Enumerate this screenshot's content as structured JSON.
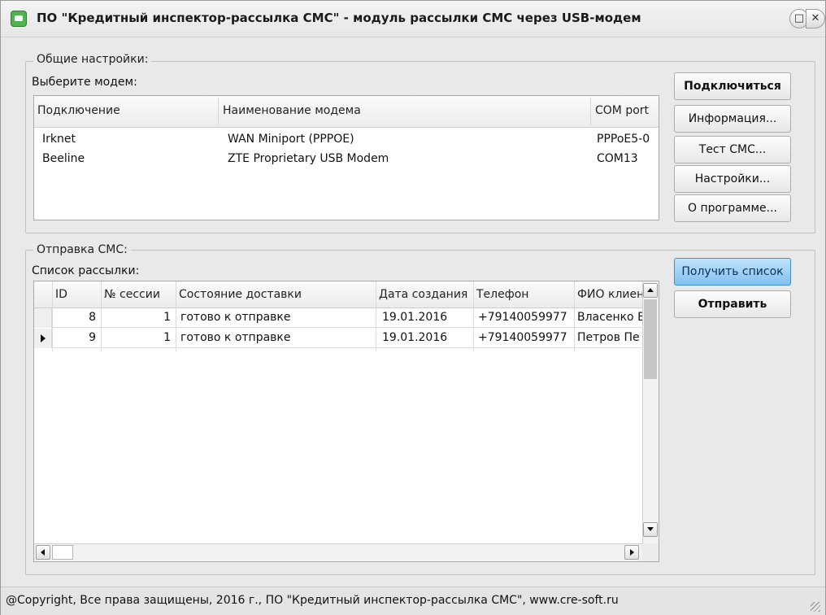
{
  "window": {
    "title": "ПО \"Кредитный инспектор-рассылка СМС\" - модуль рассылки СМС через USB-модем",
    "maximize_glyph": "□",
    "close_glyph": "✕"
  },
  "general": {
    "legend": "Общие настройки:",
    "select_label": "Выберите модем:",
    "columns": [
      "Подключение",
      "Наименование модема",
      "COM port"
    ],
    "rows": [
      {
        "connection": "Irknet",
        "modem": "WAN Miniport (PPPOE)",
        "port": "PPPoE5-0"
      },
      {
        "connection": "Beeline",
        "modem": "ZTE Proprietary USB Modem",
        "port": "COM13"
      }
    ],
    "buttons": {
      "connect": "Подключиться",
      "info": "Информация...",
      "test_sms": "Тест СМС...",
      "settings": "Настройки...",
      "about": "О программе..."
    }
  },
  "sending": {
    "legend": "Отправка СМС:",
    "list_label": "Список рассылки:",
    "columns": [
      "ID",
      "№ сессии",
      "Состояние доставки",
      "Дата создания",
      "Телефон",
      "ФИО клиен"
    ],
    "rows": [
      {
        "id": "8",
        "session": "1",
        "status": "готово к отправке",
        "created": "19.01.2016",
        "phone": "+79140059977",
        "client": "Власенко В"
      },
      {
        "id": "9",
        "session": "1",
        "status": "готово к отправке",
        "created": "19.01.2016",
        "phone": "+79140059977",
        "client": "Петров Пе"
      }
    ],
    "current_row": 1,
    "buttons": {
      "get_list": "Получить список",
      "send": "Отправить"
    }
  },
  "statusbar": {
    "text": "@Copyright, Все права защищены, 2016 г., ПО \"Кредитный инспектор-рассылка СМС\", www.cre-soft.ru"
  },
  "colors": {
    "accent_button": "#7fc3ef",
    "app_icon": "#4fb34f"
  }
}
